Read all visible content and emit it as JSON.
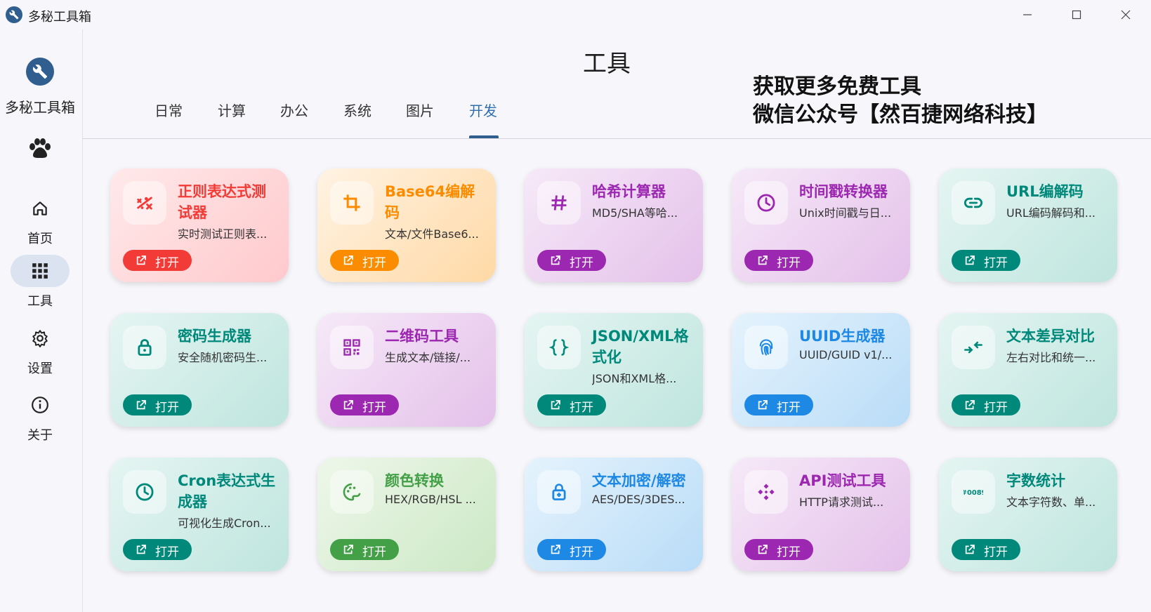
{
  "window": {
    "title": "多秘工具箱"
  },
  "sidebar": {
    "app_name": "多秘工具箱",
    "nav": [
      {
        "label": "首页",
        "icon": "home-icon"
      },
      {
        "label": "工具",
        "icon": "apps-grid-icon",
        "active": true
      },
      {
        "label": "设置",
        "icon": "gear-icon"
      },
      {
        "label": "关于",
        "icon": "info-icon"
      }
    ]
  },
  "header": {
    "title": "工具",
    "promo_line1": "获取更多免费工具",
    "promo_line2": "微信公众号【然百捷网络科技】"
  },
  "tabs": [
    "日常",
    "计算",
    "办公",
    "系统",
    "图片",
    "开发"
  ],
  "active_tab": "开发",
  "open_label": "打开",
  "colors": {
    "red": "#f23b36",
    "orange": "#fb8c00",
    "purple": "#9c27b0",
    "teal": "#00897b",
    "blue": "#1e88e5",
    "green": "#43a047",
    "brand": "#2f5e8f"
  },
  "cards": [
    {
      "title": "正则表达式测试器",
      "desc": "实时测试正则表...",
      "color": "red",
      "icon": "regex-icon"
    },
    {
      "title": "Base64编解码",
      "desc": "文本/文件Base6...",
      "color": "orange",
      "icon": "crop-icon"
    },
    {
      "title": "哈希计算器",
      "desc": "MD5/SHA等哈...",
      "color": "purple",
      "icon": "hash-icon"
    },
    {
      "title": "时间戳转换器",
      "desc": "Unix时间戳与日...",
      "color": "purple",
      "icon": "clock-icon"
    },
    {
      "title": "URL编解码",
      "desc": "URL编码解码和...",
      "color": "teal",
      "icon": "link-icon"
    },
    {
      "title": "密码生成器",
      "desc": "安全随机密码生...",
      "color": "teal",
      "icon": "lock-icon"
    },
    {
      "title": "二维码工具",
      "desc": "生成文本/链接/...",
      "color": "purple",
      "icon": "qr-code-icon"
    },
    {
      "title": "JSON/XML格式化",
      "desc": "JSON和XML格...",
      "color": "teal",
      "icon": "braces-icon"
    },
    {
      "title": "UUID生成器",
      "desc": "UUID/GUID v1/...",
      "color": "blue",
      "icon": "fingerprint-icon"
    },
    {
      "title": "文本差异对比",
      "desc": "左右对比和统一...",
      "color": "teal",
      "icon": "compare-arrows-icon"
    },
    {
      "title": "Cron表达式生成器",
      "desc": "可视化生成Cron...",
      "color": "teal",
      "icon": "clock-icon"
    },
    {
      "title": "颜色转换",
      "desc": "HEX/RGB/HSL ...",
      "color": "green",
      "icon": "palette-icon"
    },
    {
      "title": "文本加密/解密",
      "desc": "AES/DES/3DES...",
      "color": "blue",
      "icon": "lock-plus-icon"
    },
    {
      "title": "API测试工具",
      "desc": "HTTP请求测试...",
      "color": "purple",
      "icon": "api-icon"
    },
    {
      "title": "字数统计",
      "desc": "文本字符数、单...",
      "color": "teal",
      "icon": "abc-icon"
    }
  ]
}
